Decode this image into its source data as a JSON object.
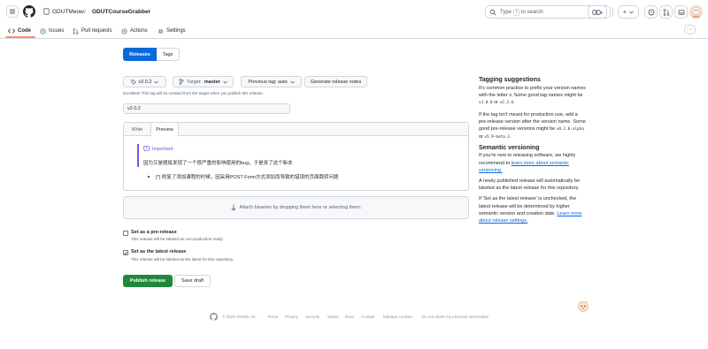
{
  "header": {
    "owner": "GDUTMeow",
    "separator": "/",
    "repo": "GDUTCourseGrabber",
    "search_prefix": "Type",
    "search_key": "/",
    "search_suffix": "to search",
    "plus_label": "+"
  },
  "tabs": [
    {
      "label": "Code",
      "icon": "code-icon"
    },
    {
      "label": "Issues",
      "icon": "issue-icon"
    },
    {
      "label": "Pull requests",
      "icon": "pull-request-icon"
    },
    {
      "label": "Actions",
      "icon": "actions-icon"
    },
    {
      "label": "Settings",
      "icon": "gear-icon"
    }
  ],
  "subnav": {
    "releases": "Releases",
    "tags": "Tags"
  },
  "form": {
    "tag": "v2.0.2",
    "target_label": "Target:",
    "target_value": "master",
    "previous_tag": "Previous tag: auto",
    "generate_notes": "Generate release notes",
    "tag_note": "Excellent! This tag will be created from the target when you publish this release.",
    "title_value": "v2.0.2",
    "write_tab": "Write",
    "preview_tab": "Preview",
    "important_label": "Important",
    "important_text": "因为又是题挺发现了一个很严重的影响使用的bug，于是发了这个新本",
    "bullet_text": "[*] 修复了添加课程的时候，因采用POST Form方式添加而导致的错误的页面跳转问题",
    "attach_text": "Attach binaries by dropping them here or selecting them.",
    "prerelease_label": "Set as a pre-release",
    "prerelease_desc": "This release will be labeled as non-production ready",
    "latest_label": "Set as the latest release",
    "latest_desc": "This release will be labeled as the latest for this repository.",
    "prerelease_checked": false,
    "latest_checked": true,
    "publish": "Publish release",
    "save_draft": "Save draft"
  },
  "sidebar": {
    "tagging_title": "Tagging suggestions",
    "tagging_p1_a": "It's common practice to prefix your version names with the letter v. Some good tag names might be",
    "tagging_p1_code1": "v1.0.0",
    "tagging_p1_or": "or",
    "tagging_p1_code2": "v2.3.4",
    "tagging_p2_a": "If the tag isn't meant for production use, add a pre-release version after the version name. Some good pre-release versions might be",
    "tagging_p2_code1": "v0.2.0-alpha",
    "tagging_p2_or": "or",
    "tagging_p2_code2": "v5.9-beta.3",
    "semver_title": "Semantic versioning",
    "semver_p1_a": "If you're new to releasing software, we highly recommend to",
    "semver_p1_link": "learn more about semantic versioning.",
    "semver_p2": "A newly published release will automatically be labeled as the latest release for this repository.",
    "semver_p3_a": "If 'Set as the latest release' is unchecked, the latest release will be determined by higher semantic version and creation date.",
    "semver_p3_link": "Learn more about release settings."
  },
  "footer": {
    "items": [
      "© 2024 GitHub, Inc.",
      "Terms",
      "Privacy",
      "Security",
      "Status",
      "Docs",
      "Contact",
      "Manage cookies",
      "Do not share my personal information"
    ]
  },
  "colors": {
    "accent": "#0969da",
    "publish": "#1f883d",
    "tab_underline": "#fd8c73",
    "important": "#8250df"
  }
}
